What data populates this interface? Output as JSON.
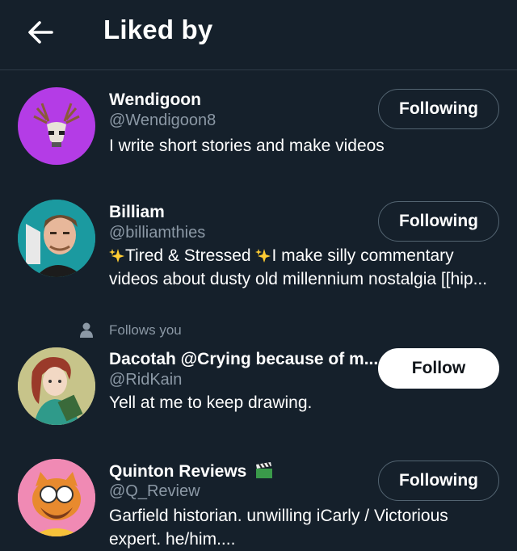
{
  "header": {
    "title": "Liked by"
  },
  "users": [
    {
      "name": "Wendigoon",
      "handle": "@Wendigoon8",
      "bio": "I write short stories and make videos",
      "button": "Following"
    },
    {
      "name": "Billiam",
      "handle": "@billiamthies",
      "bio_part1": "Tired & Stressed ",
      "bio_part2": "I make silly commentary",
      "bio_line2": "videos about dusty old millennium nostalgia [[hip...",
      "button": "Following"
    },
    {
      "follows_you": "Follows you",
      "name": "Dacotah @Crying because of m...",
      "handle": "@RidKain",
      "bio": "Yell at me to keep drawing.",
      "button": "Follow"
    },
    {
      "name": "Quinton Reviews",
      "handle": "@Q_Review",
      "bio_line1": "Garfield historian. unwilling iCarly / Victorious",
      "bio_line2": "expert. he/him....",
      "button": "Following"
    }
  ],
  "colors": {
    "background": "#15202b",
    "muted_text": "#8b98a5",
    "border": "#536471",
    "follow_button": "#ffffff",
    "avatar_wendigoon": "#b43ce6",
    "avatar_billiam": "#1b9aa0",
    "avatar_dacotah": "#c7c48a",
    "avatar_quinton": "#f08ab4"
  },
  "icons": [
    "back-arrow-icon",
    "person-icon",
    "sparkles-icon",
    "clapper-board-icon"
  ]
}
